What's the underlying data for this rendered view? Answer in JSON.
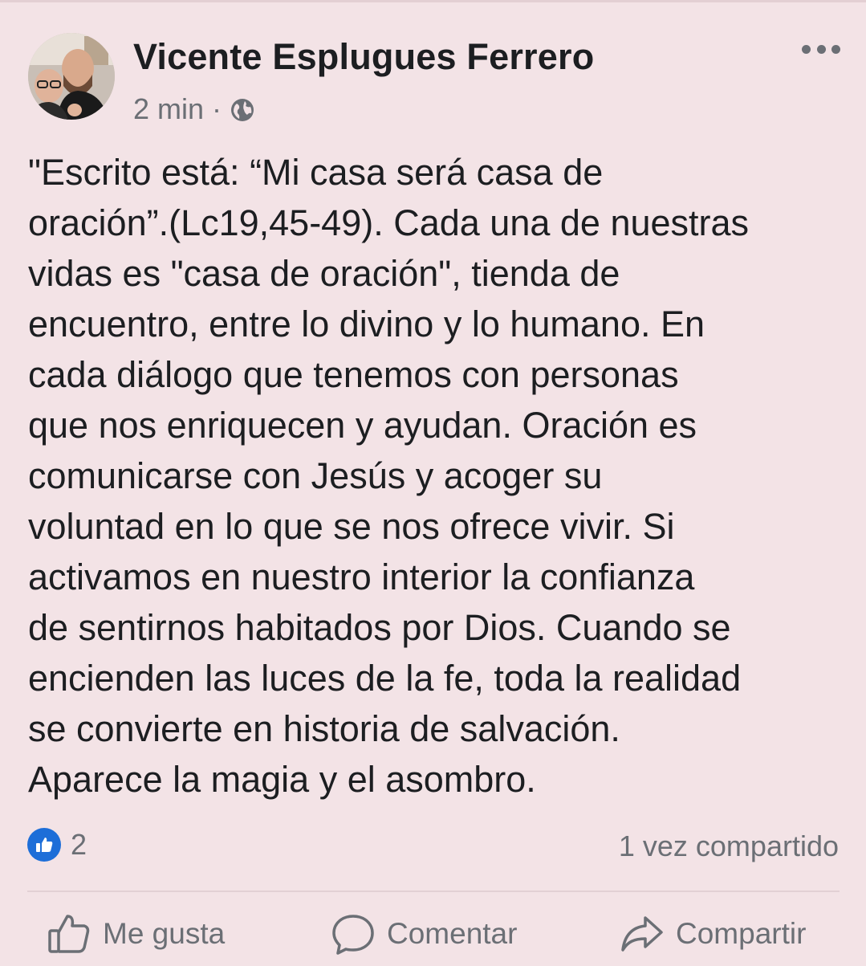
{
  "post": {
    "author": "Vicente Esplugues Ferrero",
    "time": "2 min",
    "separator": "·",
    "privacy_icon": "globe-icon",
    "menu_icon": "more-options-icon",
    "body_lines": [
      "\"Escrito está: “Mi casa será casa de",
      "oración”.(Lc19,45-49). Cada una de nuestras",
      "vidas es \"casa de oración\", tienda de",
      "encuentro, entre lo divino y lo humano. En",
      "cada diálogo que tenemos con personas",
      "que nos enriquecen y ayudan. Oración es",
      "comunicarse con Jesús y acoger su",
      "voluntad en lo que se nos ofrece vivir. Si",
      "activamos en nuestro interior la confianza",
      "de sentirnos habitados por Dios. Cuando se",
      "encienden las luces de la fe, toda la realidad",
      "se convierte en historia de salvación.",
      "Aparece la magia y el asombro."
    ]
  },
  "stats": {
    "reaction_icon": "like-reaction-icon",
    "reaction_count": "2",
    "shares": "1 vez compartido"
  },
  "actions": {
    "like": "Me gusta",
    "comment": "Comentar",
    "share": "Compartir"
  },
  "colors": {
    "background": "#f3e3e6",
    "text": "#1c1e21",
    "muted": "#6b6f75",
    "like_blue": "#1d6ed8"
  }
}
